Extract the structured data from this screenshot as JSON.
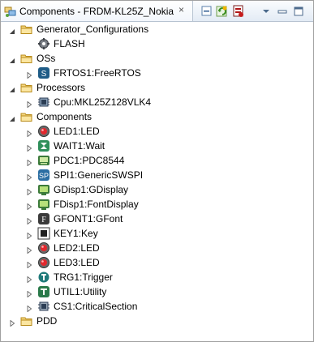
{
  "view": {
    "title": "Components - FRDM-KL25Z_Nokia",
    "close_glyph": "×",
    "toolbar": [
      {
        "name": "collapse-all-icon"
      },
      {
        "name": "refresh-icon"
      },
      {
        "name": "generate-code-icon"
      },
      {
        "name": "view-menu-icon"
      },
      {
        "name": "minimize-icon"
      },
      {
        "name": "maximize-icon"
      }
    ]
  },
  "tree": [
    {
      "label": "Generator_Configurations",
      "kind": "folder",
      "expanded": true,
      "depth": 0
    },
    {
      "label": "FLASH",
      "kind": "gear",
      "expanded": null,
      "depth": 1
    },
    {
      "label": "OSs",
      "kind": "folder",
      "expanded": true,
      "depth": 0
    },
    {
      "label": "FRTOS1:FreeRTOS",
      "kind": "os",
      "expanded": false,
      "depth": 1
    },
    {
      "label": "Processors",
      "kind": "folder",
      "expanded": true,
      "depth": 0
    },
    {
      "label": "Cpu:MKL25Z128VLK4",
      "kind": "cpu",
      "expanded": false,
      "depth": 1
    },
    {
      "label": "Components",
      "kind": "folder",
      "expanded": true,
      "depth": 0
    },
    {
      "label": "LED1:LED",
      "kind": "led",
      "expanded": false,
      "depth": 1
    },
    {
      "label": "WAIT1:Wait",
      "kind": "wait",
      "expanded": false,
      "depth": 1
    },
    {
      "label": "PDC1:PDC8544",
      "kind": "lcd",
      "expanded": false,
      "depth": 1
    },
    {
      "label": "SPI1:GenericSWSPI",
      "kind": "spi",
      "expanded": false,
      "depth": 1
    },
    {
      "label": "GDisp1:GDisplay",
      "kind": "display",
      "expanded": false,
      "depth": 1
    },
    {
      "label": "FDisp1:FontDisplay",
      "kind": "display",
      "expanded": false,
      "depth": 1
    },
    {
      "label": "GFONT1:GFont",
      "kind": "font",
      "expanded": false,
      "depth": 1
    },
    {
      "label": "KEY1:Key",
      "kind": "key",
      "expanded": false,
      "depth": 1
    },
    {
      "label": "LED2:LED",
      "kind": "led",
      "expanded": false,
      "depth": 1
    },
    {
      "label": "LED3:LED",
      "kind": "led",
      "expanded": false,
      "depth": 1
    },
    {
      "label": "TRG1:Trigger",
      "kind": "trigger",
      "expanded": false,
      "depth": 1
    },
    {
      "label": "UTIL1:Utility",
      "kind": "utility",
      "expanded": false,
      "depth": 1
    },
    {
      "label": "CS1:CriticalSection",
      "kind": "critical",
      "expanded": false,
      "depth": 1
    },
    {
      "label": "PDD",
      "kind": "folder",
      "expanded": false,
      "depth": 0
    }
  ]
}
